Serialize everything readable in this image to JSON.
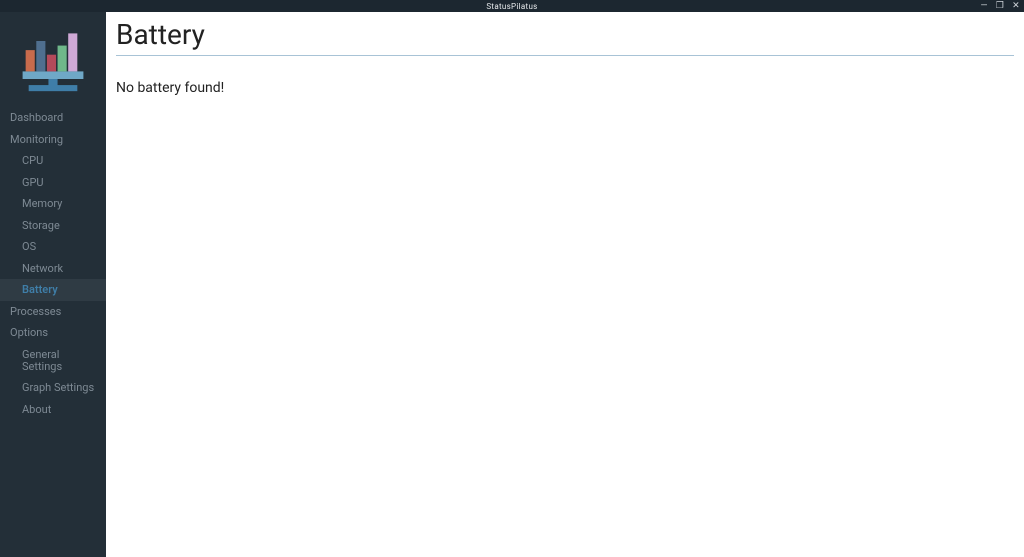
{
  "window": {
    "title": "StatusPilatus"
  },
  "sidebar": {
    "items": {
      "dashboard": "Dashboard",
      "monitoring": "Monitoring",
      "cpu": "CPU",
      "gpu": "GPU",
      "memory": "Memory",
      "storage": "Storage",
      "os": "OS",
      "network": "Network",
      "battery": "Battery",
      "processes": "Processes",
      "options": "Options",
      "general_settings": "General Settings",
      "graph_settings": "Graph Settings",
      "about": "About"
    }
  },
  "main": {
    "title": "Battery",
    "message": "No battery found!"
  },
  "controls": {
    "minimize": "—",
    "maximize": "❐",
    "close": "✕"
  }
}
